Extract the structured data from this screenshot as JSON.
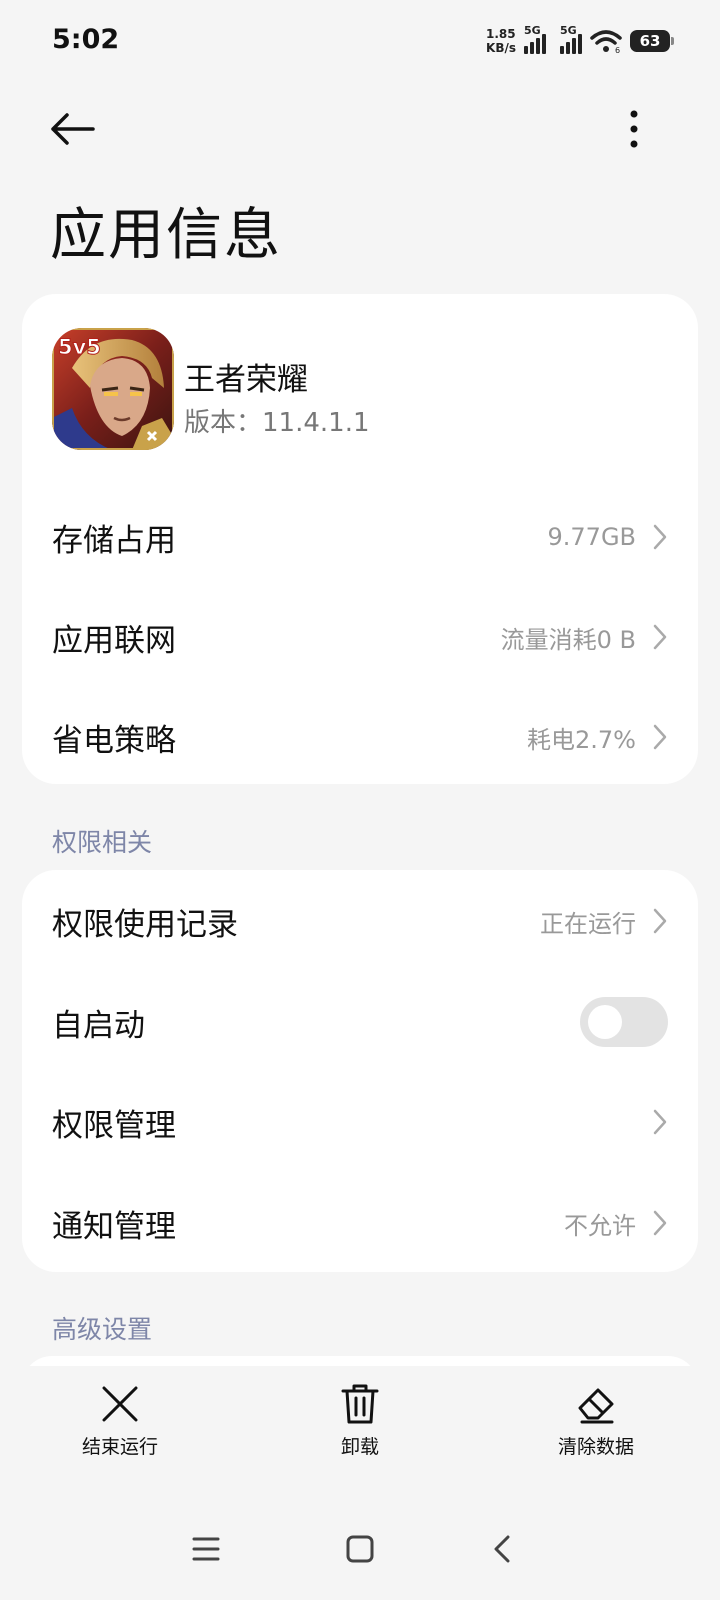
{
  "status_bar": {
    "time": "5:02",
    "net_speed_value": "1.85",
    "net_speed_unit": "KB/s",
    "sim1_label": "5G",
    "sim2_label": "5G",
    "wifi_label": "6",
    "battery": "63"
  },
  "header": {
    "title": "应用信息",
    "back_icon": "arrow-left-icon",
    "more_icon": "more-vertical-icon"
  },
  "app": {
    "name": "王者荣耀",
    "version": "版本：11.4.1.1",
    "icon_badge": "5v5"
  },
  "app_rows": [
    {
      "label": "存储占用",
      "value": "9.77GB"
    },
    {
      "label": "应用联网",
      "value": "流量消耗0 B"
    },
    {
      "label": "省电策略",
      "value": "耗电2.7%"
    }
  ],
  "permissions_section": {
    "header": "权限相关",
    "rows": [
      {
        "label": "权限使用记录",
        "value": "正在运行"
      },
      {
        "label": "自启动",
        "toggle_on": false
      },
      {
        "label": "权限管理",
        "value": ""
      },
      {
        "label": "通知管理",
        "value": "不允许"
      }
    ]
  },
  "advanced_section": {
    "header": "高级设置"
  },
  "bottom_actions": [
    {
      "label": "结束运行",
      "icon": "close-icon"
    },
    {
      "label": "卸载",
      "icon": "trash-icon"
    },
    {
      "label": "清除数据",
      "icon": "eraser-icon"
    }
  ],
  "nav_bar": {
    "menu_icon": "menu-icon",
    "home_icon": "home-icon",
    "back_icon": "back-chevron-icon"
  }
}
